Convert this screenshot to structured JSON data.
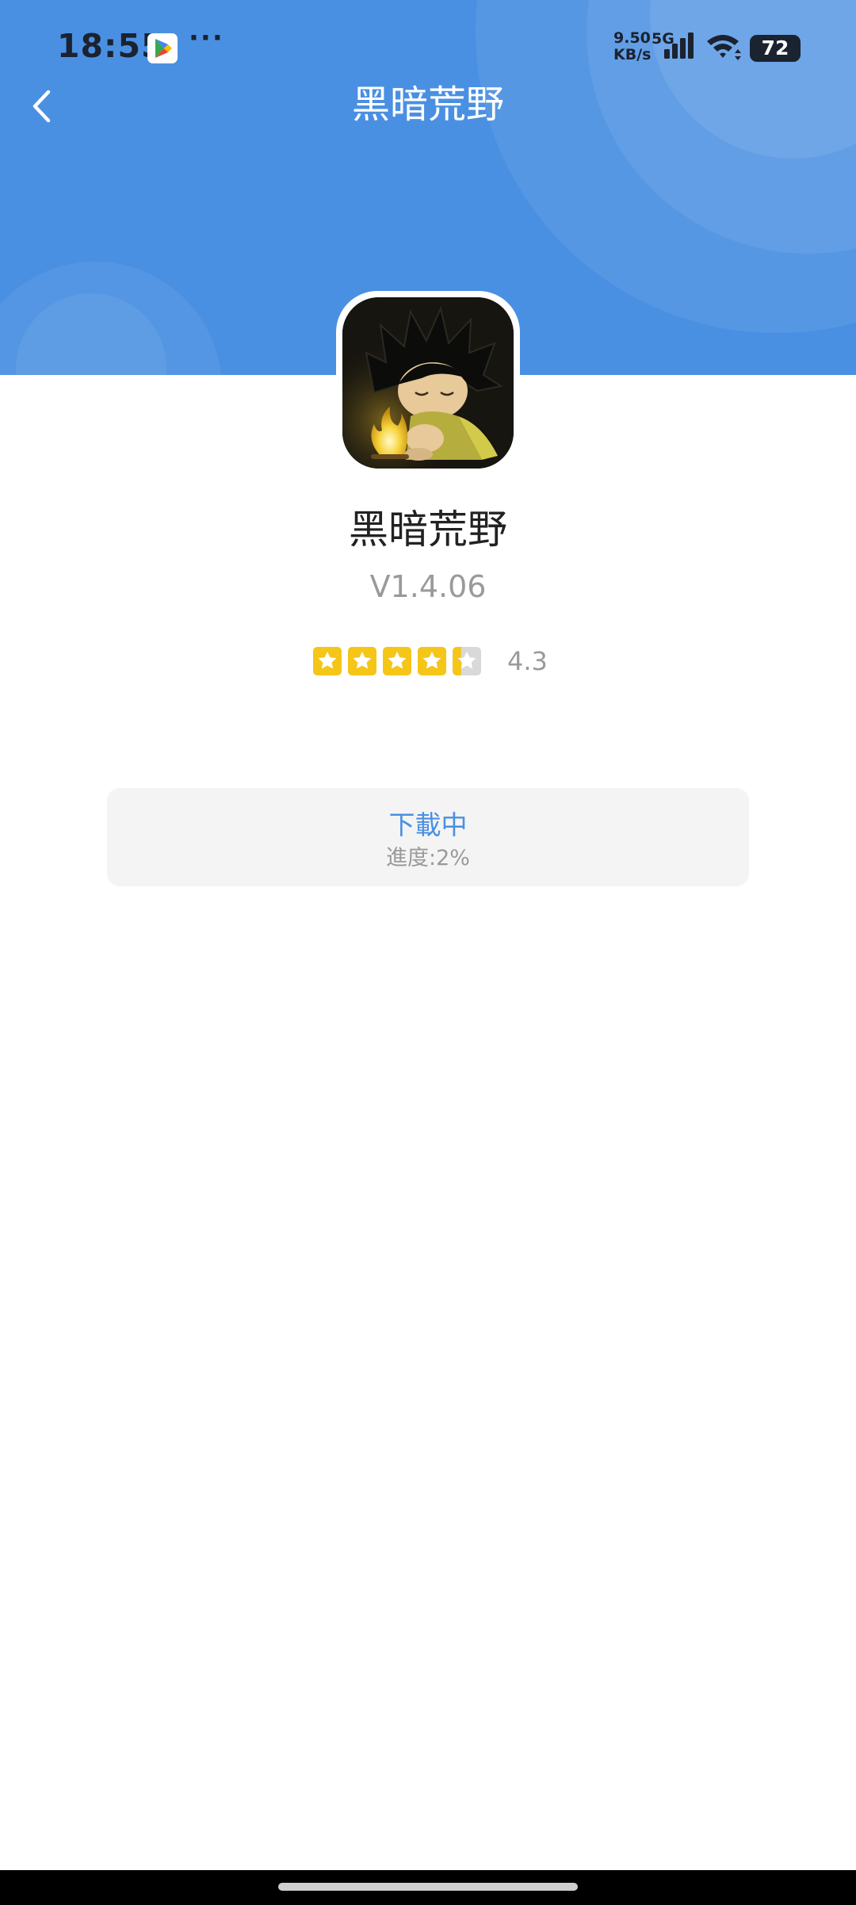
{
  "status_bar": {
    "time": "18:55",
    "net_speed_value": "9.50",
    "net_speed_unit": "KB/s",
    "network_gen": "5G",
    "battery": "72",
    "icons": [
      "play-store-icon",
      "more-dots-icon",
      "signal-icon",
      "wifi-icon",
      "battery-icon"
    ]
  },
  "header": {
    "title": "黑暗荒野",
    "back_icon": "chevron-left-icon",
    "background_color": "#4a90e2"
  },
  "app": {
    "name": "黑暗荒野",
    "version": "V1.4.06",
    "rating": 4.3,
    "rating_label": "4.3",
    "stars_max": 5,
    "star_color": "#f5c518"
  },
  "download": {
    "status": "下載中",
    "progress_label": "進度:2%",
    "progress": 0.02,
    "accent_color": "#4a90e2"
  }
}
